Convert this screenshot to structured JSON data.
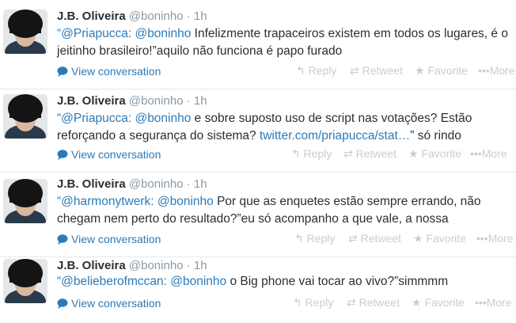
{
  "actions": {
    "reply": "Reply",
    "retweet": "Retweet",
    "favorite": "Favorite",
    "more": "More"
  },
  "view_conversation": "View conversation",
  "tweets": [
    {
      "name": "J.B. Oliveira",
      "handle": "@boninho",
      "time": "1h",
      "mention1": "“@Priapucca:",
      "mention2": "@boninho",
      "text": " Infelizmente trapaceiros existem em todos os lugares, é o jeitinho brasileiro!”aquilo não funciona é papo furado"
    },
    {
      "name": "J.B. Oliveira",
      "handle": "@boninho",
      "time": "1h",
      "mention1": "“@Priapucca:",
      "mention2": "@boninho",
      "text": " e sobre suposto uso de script nas votações? Estão reforçando a segurança do sistema? ",
      "link": "twitter.com/priapucca/stat…",
      "text_after": "” só rindo"
    },
    {
      "name": "J.B. Oliveira",
      "handle": "@boninho",
      "time": "1h",
      "mention1": "“@harmonytwerk:",
      "mention2": "@boninho",
      "text": " Por que as enquetes estão sempre errando, não chegam nem perto do resultado?”eu só acompanho a que vale, a nossa"
    },
    {
      "name": "J.B. Oliveira",
      "handle": "@boninho",
      "time": "1h",
      "mention1": "“@belieberofmccan:",
      "mention2": "@boninho",
      "text": " o Big phone vai tocar ao vivo?”simmmm"
    }
  ]
}
